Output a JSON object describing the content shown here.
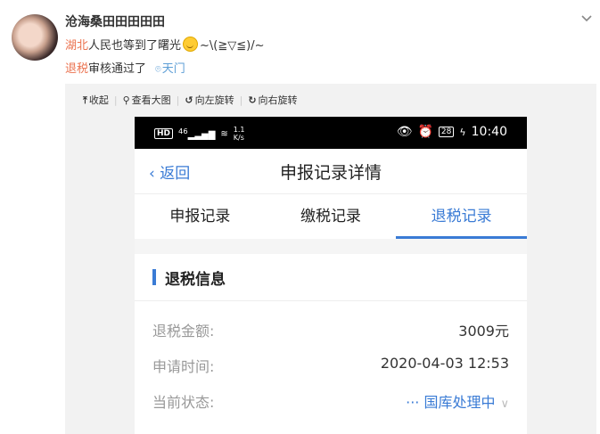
{
  "post": {
    "username": "沧海桑田田田田田",
    "topic1": "湖北",
    "text1": "人民也等到了曙光",
    "kaomoji": "~\\(≧▽≦)/~",
    "topic2": "退税",
    "text2": "审核通过了",
    "location": "天门"
  },
  "media_toolbar": {
    "collapse": "收起",
    "view_large": "查看大图",
    "rotate_left": "向左旋转",
    "rotate_right": "向右旋转"
  },
  "phone": {
    "statusbar": {
      "hd": "HD",
      "network": "46",
      "speed_value": "1.1",
      "speed_unit": "K/s",
      "battery": "28",
      "time": "10:40"
    },
    "nav": {
      "back": "返回",
      "title": "申报记录详情"
    },
    "tabs": [
      {
        "label": "申报记录",
        "active": false
      },
      {
        "label": "缴税记录",
        "active": false
      },
      {
        "label": "退税记录",
        "active": true
      }
    ],
    "section_title": "退税信息",
    "rows": [
      {
        "label": "退税金额:",
        "value": "3009元"
      },
      {
        "label": "申请时间:",
        "value": "2020-04-03 12:53"
      },
      {
        "label": "当前状态:",
        "value": "国库处理中"
      }
    ]
  },
  "colors": {
    "topic": "#eb7350",
    "location": "#5d9ed6",
    "accent": "#3a7bd5"
  }
}
